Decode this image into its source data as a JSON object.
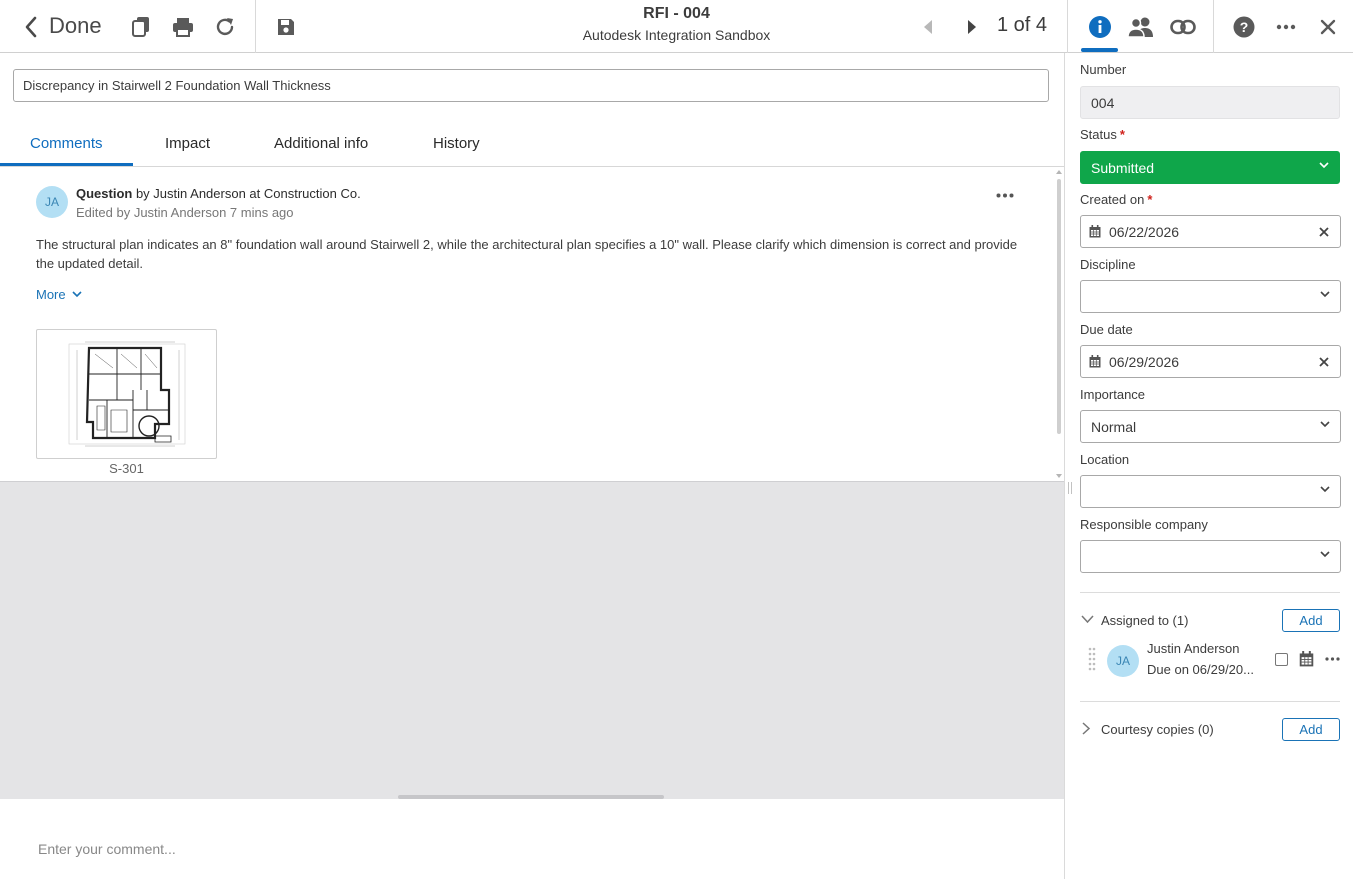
{
  "header": {
    "done_label": "Done",
    "title": "RFI - 004",
    "subtitle": "Autodesk Integration Sandbox",
    "pager": "1 of 4"
  },
  "rfi": {
    "title_value": "Discrepancy in Stairwell 2 Foundation Wall Thickness"
  },
  "tabs": [
    {
      "label": "Comments",
      "active": true
    },
    {
      "label": "Impact"
    },
    {
      "label": "Additional info"
    },
    {
      "label": "History"
    }
  ],
  "comment": {
    "avatar_initials": "JA",
    "type": "Question",
    "author_text": " by Justin Anderson at Construction Co.",
    "edited": "Edited by Justin Anderson 7 mins ago",
    "body": "The structural plan indicates an 8\" foundation wall around Stairwell 2, while the architectural plan specifies a 10\" wall. Please clarify which dimension is correct and provide the updated detail.",
    "more_label": "More",
    "attachment_label": "S-301"
  },
  "composer": {
    "placeholder": "Enter your comment..."
  },
  "details": {
    "number_label": "Number",
    "number_value": "004",
    "status_label": "Status",
    "status_value": "Submitted",
    "created_label": "Created on",
    "created_value": "06/22/2026",
    "discipline_label": "Discipline",
    "discipline_value": "",
    "due_label": "Due date",
    "due_value": "06/29/2026",
    "importance_label": "Importance",
    "importance_value": "Normal",
    "location_label": "Location",
    "location_value": "",
    "company_label": "Responsible company",
    "company_value": ""
  },
  "assigned": {
    "title": "Assigned to (1)",
    "add_label": "Add",
    "assignee_initials": "JA",
    "assignee_name": "Justin Anderson",
    "assignee_due": "Due on 06/29/20..."
  },
  "courtesy": {
    "title": "Courtesy copies (0)",
    "add_label": "Add"
  },
  "colors": {
    "accent": "#0f6dbf",
    "status_submitted": "#0fa64a",
    "required": "#d0221c"
  },
  "icons": [
    "back-icon",
    "copy-icon",
    "print-icon",
    "refresh-icon",
    "save-icon",
    "prev-icon",
    "next-icon",
    "info-icon",
    "people-icon",
    "link-icon",
    "help-icon",
    "more-icon",
    "close-icon",
    "calendar-icon",
    "chevron-down-icon",
    "clear-icon"
  ]
}
